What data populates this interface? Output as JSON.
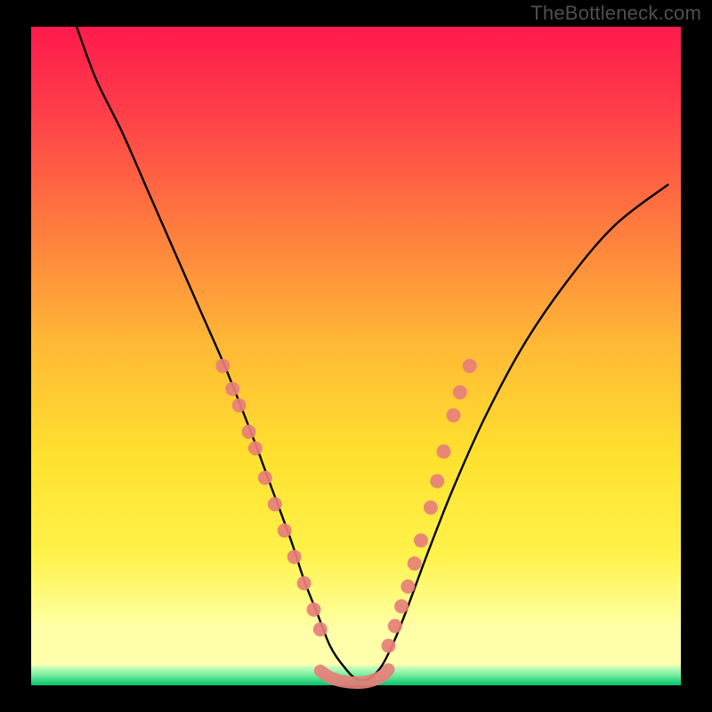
{
  "watermark": "TheBottleneck.com",
  "chart_data": {
    "type": "line",
    "title": "",
    "xlabel": "",
    "ylabel": "",
    "xlim": [
      0,
      100
    ],
    "ylim": [
      0,
      100
    ],
    "background_gradient": {
      "top_color": "#ff1a4c",
      "mid_color": "#ffd400",
      "bottom_color": "#ffffb0",
      "base_stripe_color": "#00d87a"
    },
    "series": [
      {
        "name": "bottleneck-curve",
        "style": "line",
        "color": "#000000",
        "x": [
          7,
          10,
          14,
          18,
          22,
          26,
          30,
          34,
          37,
          40,
          42,
          44,
          46,
          48,
          50,
          52,
          54,
          56,
          58,
          61,
          65,
          70,
          76,
          83,
          90,
          98
        ],
        "y": [
          100,
          92,
          84,
          75,
          66,
          57,
          48,
          38,
          30,
          22,
          16,
          11,
          6,
          3,
          1,
          1,
          3,
          7,
          12,
          20,
          30,
          41,
          52,
          62,
          70,
          76
        ]
      },
      {
        "name": "markers-left",
        "style": "scatter",
        "color": "#e77f7a",
        "x": [
          29.5,
          31.0,
          32.0,
          33.5,
          34.5,
          36.0,
          37.5,
          39.0,
          40.5,
          42.0,
          43.5,
          44.5
        ],
        "y": [
          48.5,
          45.0,
          42.5,
          38.5,
          36.0,
          31.5,
          27.5,
          23.5,
          19.5,
          15.5,
          11.5,
          8.5
        ]
      },
      {
        "name": "markers-right",
        "style": "scatter",
        "color": "#e77f7a",
        "x": [
          55.0,
          56.0,
          57.0,
          58.0,
          59.0,
          60.0,
          61.5,
          62.5,
          63.5,
          65.0,
          66.0,
          67.5
        ],
        "y": [
          6.0,
          9.0,
          12.0,
          15.0,
          18.5,
          22.0,
          27.0,
          31.0,
          35.5,
          41.0,
          44.5,
          48.5
        ]
      },
      {
        "name": "bottom-band",
        "style": "line",
        "color": "#e77f7a",
        "x": [
          44.5,
          46,
          48,
          50,
          52,
          54,
          55.0
        ],
        "y": [
          2.2,
          1.2,
          0.6,
          0.4,
          0.6,
          1.4,
          2.4
        ]
      }
    ]
  }
}
